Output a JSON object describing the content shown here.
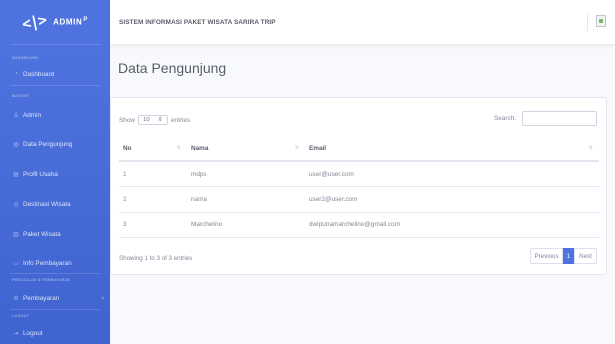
{
  "brand": {
    "name": "ADMIN",
    "sup": "P"
  },
  "sidebar": {
    "headings": [
      "DASHBOARD",
      "MASTER",
      "PENJUALAN & PEMBAYARAN",
      "LOGOUT"
    ],
    "items": [
      {
        "label": "Dashboard",
        "icon": "dashboard-icon"
      },
      {
        "label": "Admin",
        "icon": "user-icon"
      },
      {
        "label": "Data Pengunjung",
        "icon": "users-icon"
      },
      {
        "label": "Profil Usaha",
        "icon": "profile-icon"
      },
      {
        "label": "Destinasi Wisata",
        "icon": "location-icon"
      },
      {
        "label": "Paket Wisata",
        "icon": "package-icon"
      },
      {
        "label": "Info Pembayaran",
        "icon": "card-icon"
      },
      {
        "label": "Pembayaran",
        "icon": "payment-icon"
      },
      {
        "label": "Logout",
        "icon": "logout-icon"
      }
    ]
  },
  "topbar": {
    "title": "SISTEM INFORMASI PAKET WISATA SARIRA TRIP"
  },
  "main": {
    "title": "Data Pengunjung",
    "show_label": "Show",
    "entries_value": "10",
    "entries_label": "entries",
    "search_label": "Search:",
    "search_value": ""
  },
  "table": {
    "headers": [
      "No",
      "Nama",
      "Email"
    ],
    "rows": [
      {
        "no": "1",
        "nama": "mdps",
        "email": "user@user.com"
      },
      {
        "no": "2",
        "nama": "nama",
        "email": "user2@user.com"
      },
      {
        "no": "3",
        "nama": "Marchelino",
        "email": "dwiputramarchelino@gmail.com"
      }
    ]
  },
  "footer": {
    "info": "Showing 1 to 3 of 3 entries",
    "previous": "Previous",
    "page": "1",
    "next": "Next"
  },
  "colors": {
    "primary": "#4e73df",
    "text": "#5a5c69",
    "muted": "#858796"
  }
}
